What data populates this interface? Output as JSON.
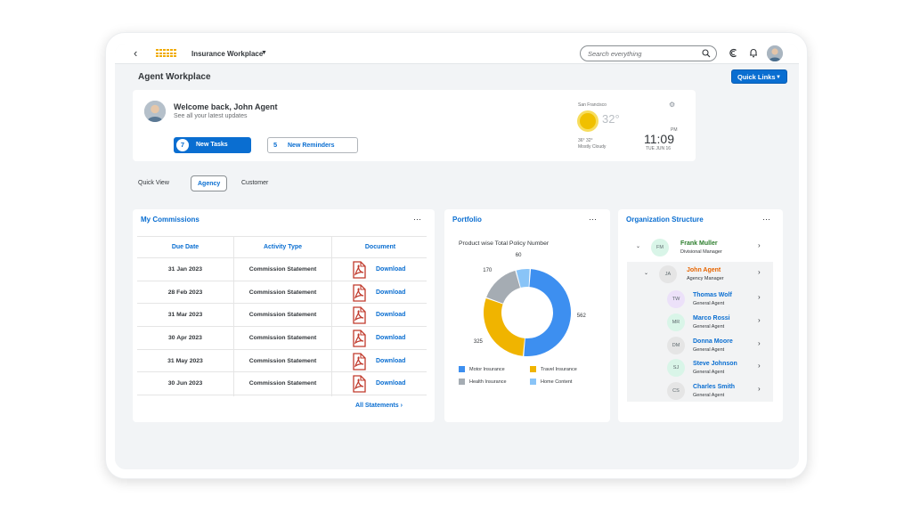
{
  "shell": {
    "title": "Insurance Workplace",
    "search_placeholder": "Search everything"
  },
  "page": {
    "title": "Agent Workplace",
    "quick_links": "Quick Links"
  },
  "welcome": {
    "title": "Welcome back, John Agent",
    "subtitle": "See all your latest updates",
    "tasks_count": "7",
    "tasks_label": "New Tasks",
    "reminders_count": "5",
    "reminders_label": "New Reminders"
  },
  "weather": {
    "city": "San Francisco",
    "temp": "32°",
    "hilo": "36° 32°",
    "condition": "Mostly Cloudy",
    "ampm": "PM",
    "time": "11:09",
    "date": "TUE JUN 16"
  },
  "tabs": [
    "Quick View",
    "Agency",
    "Customer"
  ],
  "commissions": {
    "title": "My Commissions",
    "headers": [
      "Due Date",
      "Activity Type",
      "Document"
    ],
    "rows": [
      {
        "date": "31 Jan 2023",
        "type": "Commission Statement",
        "doc": "Download"
      },
      {
        "date": "28 Feb 2023",
        "type": "Commission Statement",
        "doc": "Download"
      },
      {
        "date": "31 Mar 2023",
        "type": "Commission Statement",
        "doc": "Download"
      },
      {
        "date": "30 Apr 2023",
        "type": "Commission Statement",
        "doc": "Download"
      },
      {
        "date": "31 May 2023",
        "type": "Commission Statement",
        "doc": "Download"
      },
      {
        "date": "30 Jun 2023",
        "type": "Commission Statement",
        "doc": "Download"
      }
    ],
    "all_link": "All Statements"
  },
  "portfolio": {
    "title": "Portfolio"
  },
  "chart_data": {
    "type": "pie",
    "title": "Product wise Total Policy Number",
    "categories": [
      "Motor Insurance",
      "Travel Insurance",
      "Health Insurance",
      "Home Content"
    ],
    "values": [
      562,
      325,
      170,
      60
    ],
    "colors": [
      "#3d8ff0",
      "#f0b400",
      "#a5acb3",
      "#89c4f7"
    ],
    "legend": "bottom"
  },
  "org": {
    "title": "Organization Structure",
    "nodes": [
      {
        "initials": "FM",
        "name": "Frank Muller",
        "role": "Divisional Manager",
        "color": "#d9f5e8",
        "name_color": "#2b7d2b"
      },
      {
        "initials": "JA",
        "name": "John Agent",
        "role": "Agency Manager",
        "color": "#e5e5e5",
        "name_color": "#e76500"
      },
      {
        "initials": "TW",
        "name": "Thomas Wolf",
        "role": "General Agent",
        "color": "#ece1f9",
        "name_color": "#0a6ed1"
      },
      {
        "initials": "MR",
        "name": "Marco Rossi",
        "role": "General Agent",
        "color": "#d9f5e8",
        "name_color": "#0a6ed1"
      },
      {
        "initials": "DM",
        "name": "Donna Moore",
        "role": "General Agent",
        "color": "#e5e5e5",
        "name_color": "#0a6ed1"
      },
      {
        "initials": "SJ",
        "name": "Steve Johnson",
        "role": "General Agent",
        "color": "#d9f5e8",
        "name_color": "#0a6ed1"
      },
      {
        "initials": "CS",
        "name": "Charles Smith",
        "role": "General Agent",
        "color": "#e5e5e5",
        "name_color": "#0a6ed1"
      }
    ]
  }
}
